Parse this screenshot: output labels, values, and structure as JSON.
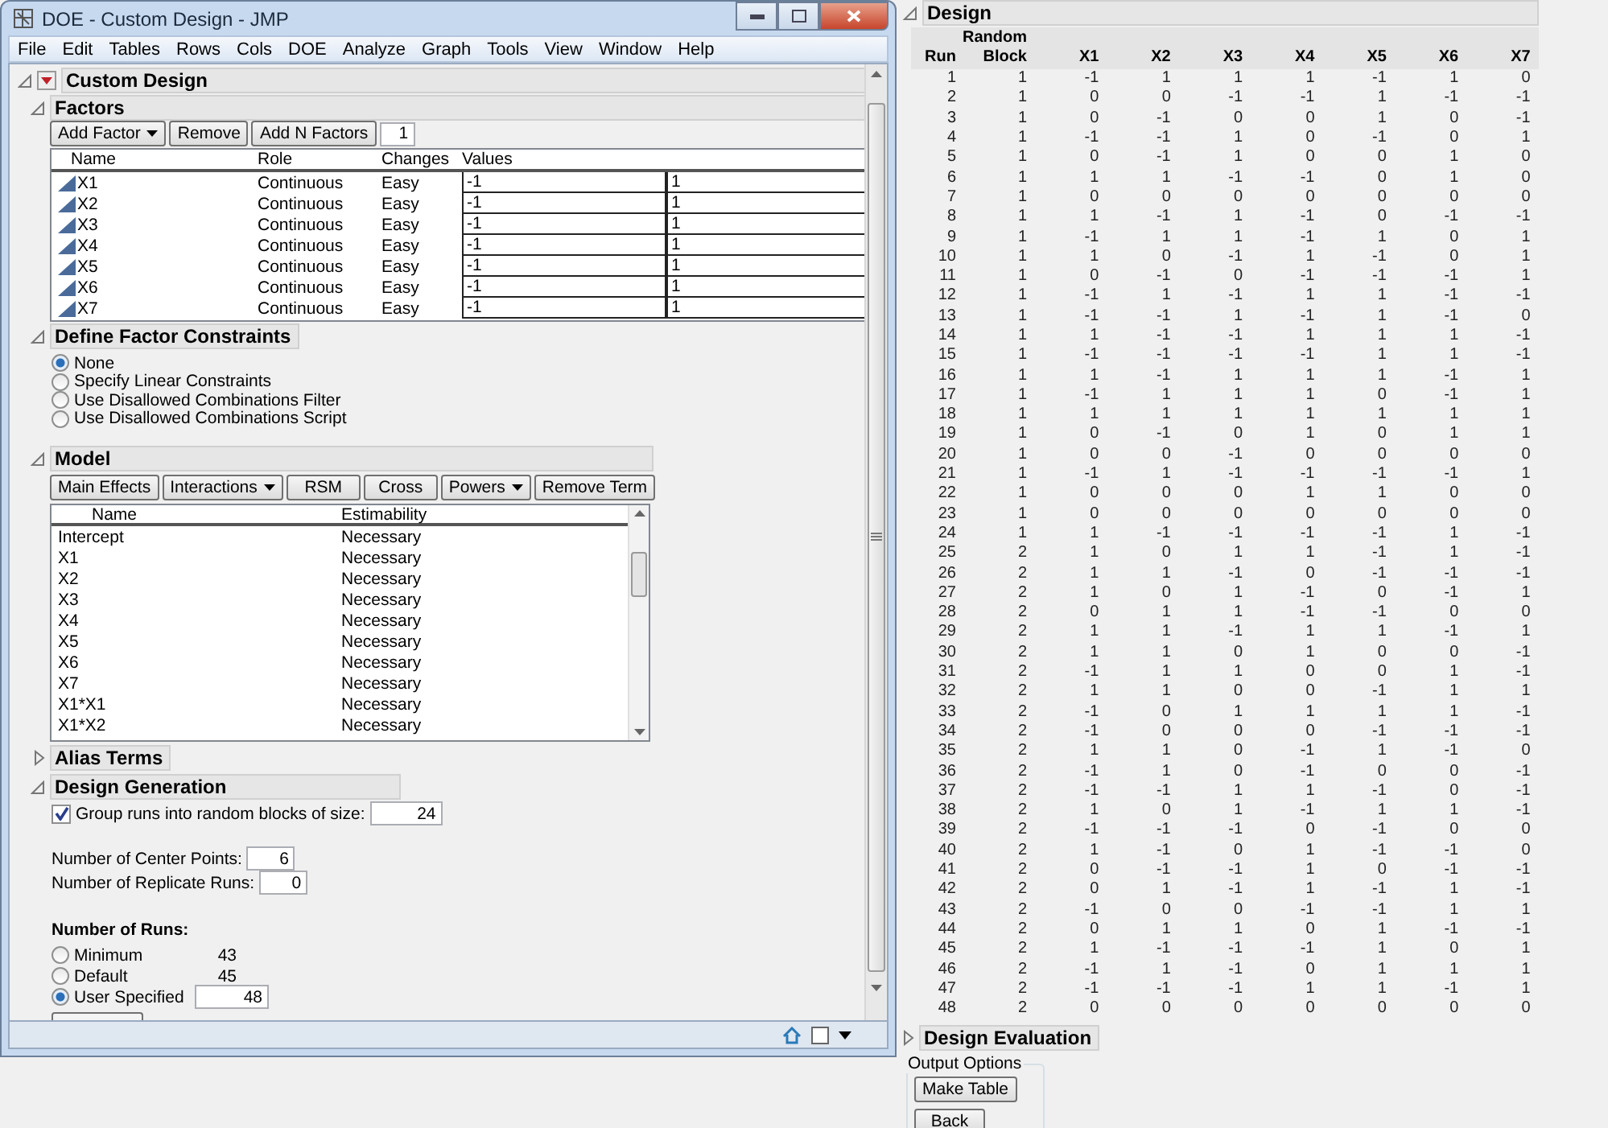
{
  "window": {
    "title": "DOE - Custom Design - JMP"
  },
  "menu": [
    "File",
    "Edit",
    "Tables",
    "Rows",
    "Cols",
    "DOE",
    "Analyze",
    "Graph",
    "Tools",
    "View",
    "Window",
    "Help"
  ],
  "custom_design": {
    "title": "Custom Design",
    "expanded": true
  },
  "factors": {
    "title": "Factors",
    "expanded": true,
    "buttons": [
      {
        "label": "Add Factor",
        "kind": "dropdown"
      },
      {
        "label": "Remove",
        "kind": "plain"
      },
      {
        "label": "Add N Factors",
        "kind": "plain"
      }
    ],
    "n_factors": "1",
    "columns": [
      "Name",
      "Role",
      "Changes",
      "Values"
    ],
    "rows": [
      {
        "name": "X1",
        "role": "Continuous",
        "changes": "Easy",
        "low": "-1",
        "high": "1"
      },
      {
        "name": "X2",
        "role": "Continuous",
        "changes": "Easy",
        "low": "-1",
        "high": "1"
      },
      {
        "name": "X3",
        "role": "Continuous",
        "changes": "Easy",
        "low": "-1",
        "high": "1"
      },
      {
        "name": "X4",
        "role": "Continuous",
        "changes": "Easy",
        "low": "-1",
        "high": "1"
      },
      {
        "name": "X5",
        "role": "Continuous",
        "changes": "Easy",
        "low": "-1",
        "high": "1"
      },
      {
        "name": "X6",
        "role": "Continuous",
        "changes": "Easy",
        "low": "-1",
        "high": "1"
      },
      {
        "name": "X7",
        "role": "Continuous",
        "changes": "Easy",
        "low": "-1",
        "high": "1"
      }
    ]
  },
  "constraints": {
    "title": "Define Factor Constraints",
    "expanded": true,
    "options": [
      {
        "label": "None",
        "selected": true
      },
      {
        "label": "Specify Linear Constraints",
        "selected": false
      },
      {
        "label": "Use Disallowed Combinations Filter",
        "selected": false
      },
      {
        "label": "Use Disallowed Combinations Script",
        "selected": false
      }
    ]
  },
  "model": {
    "title": "Model",
    "expanded": true,
    "buttons": [
      {
        "label": "Main Effects",
        "kind": "plain"
      },
      {
        "label": "Interactions",
        "kind": "dropdown"
      },
      {
        "label": "RSM",
        "kind": "plain"
      },
      {
        "label": "Cross",
        "kind": "plain"
      },
      {
        "label": "Powers",
        "kind": "dropdown"
      },
      {
        "label": "Remove Term",
        "kind": "plain"
      }
    ],
    "columns": [
      "Name",
      "Estimability"
    ],
    "rows": [
      {
        "name": "Intercept",
        "estimability": "Necessary"
      },
      {
        "name": "X1",
        "estimability": "Necessary"
      },
      {
        "name": "X2",
        "estimability": "Necessary"
      },
      {
        "name": "X3",
        "estimability": "Necessary"
      },
      {
        "name": "X4",
        "estimability": "Necessary"
      },
      {
        "name": "X5",
        "estimability": "Necessary"
      },
      {
        "name": "X6",
        "estimability": "Necessary"
      },
      {
        "name": "X7",
        "estimability": "Necessary"
      },
      {
        "name": "X1*X1",
        "estimability": "Necessary"
      },
      {
        "name": "X1*X2",
        "estimability": "Necessary"
      }
    ]
  },
  "alias_terms": {
    "title": "Alias Terms",
    "expanded": false
  },
  "design_generation": {
    "title": "Design Generation",
    "expanded": true,
    "group_runs": {
      "label": "Group runs into random blocks of size:",
      "checked": true,
      "value": "24"
    },
    "fields": [
      {
        "label": "Number of Center Points:",
        "value": "6"
      },
      {
        "label": "Number of Replicate Runs:",
        "value": "0"
      }
    ],
    "runs": {
      "title": "Number of Runs:",
      "options": [
        {
          "label": "Minimum",
          "kind": "count",
          "count": "43",
          "selected": false
        },
        {
          "label": "Default",
          "kind": "count",
          "count": "45",
          "selected": false
        },
        {
          "label": "User Specified",
          "kind": "field",
          "value": "48",
          "selected": true
        }
      ]
    }
  },
  "design": {
    "title": "Design",
    "expanded": true,
    "columns": [
      "Run",
      "Random Block",
      "X1",
      "X2",
      "X3",
      "X4",
      "X5",
      "X6",
      "X7"
    ],
    "rows": [
      [
        "1",
        "1",
        "-1",
        "1",
        "1",
        "1",
        "-1",
        "1",
        "0"
      ],
      [
        "2",
        "1",
        "0",
        "0",
        "-1",
        "-1",
        "1",
        "-1",
        "-1"
      ],
      [
        "3",
        "1",
        "0",
        "-1",
        "0",
        "0",
        "1",
        "0",
        "-1"
      ],
      [
        "4",
        "1",
        "-1",
        "-1",
        "1",
        "0",
        "-1",
        "0",
        "1"
      ],
      [
        "5",
        "1",
        "0",
        "-1",
        "1",
        "0",
        "0",
        "1",
        "0"
      ],
      [
        "6",
        "1",
        "1",
        "1",
        "-1",
        "-1",
        "0",
        "1",
        "0"
      ],
      [
        "7",
        "1",
        "0",
        "0",
        "0",
        "0",
        "0",
        "0",
        "0"
      ],
      [
        "8",
        "1",
        "1",
        "-1",
        "1",
        "-1",
        "0",
        "-1",
        "-1"
      ],
      [
        "9",
        "1",
        "-1",
        "1",
        "1",
        "-1",
        "1",
        "0",
        "1"
      ],
      [
        "10",
        "1",
        "1",
        "0",
        "-1",
        "1",
        "-1",
        "0",
        "1"
      ],
      [
        "11",
        "1",
        "0",
        "-1",
        "0",
        "-1",
        "-1",
        "-1",
        "1"
      ],
      [
        "12",
        "1",
        "-1",
        "1",
        "-1",
        "1",
        "1",
        "-1",
        "-1"
      ],
      [
        "13",
        "1",
        "-1",
        "-1",
        "1",
        "-1",
        "1",
        "-1",
        "0"
      ],
      [
        "14",
        "1",
        "1",
        "-1",
        "-1",
        "1",
        "1",
        "1",
        "-1"
      ],
      [
        "15",
        "1",
        "-1",
        "-1",
        "-1",
        "-1",
        "1",
        "1",
        "-1"
      ],
      [
        "16",
        "1",
        "1",
        "-1",
        "1",
        "1",
        "1",
        "-1",
        "1"
      ],
      [
        "17",
        "1",
        "-1",
        "1",
        "1",
        "1",
        "0",
        "-1",
        "1"
      ],
      [
        "18",
        "1",
        "1",
        "1",
        "1",
        "1",
        "1",
        "1",
        "1"
      ],
      [
        "19",
        "1",
        "0",
        "-1",
        "0",
        "1",
        "0",
        "1",
        "1"
      ],
      [
        "20",
        "1",
        "0",
        "0",
        "-1",
        "0",
        "0",
        "0",
        "0"
      ],
      [
        "21",
        "1",
        "-1",
        "1",
        "-1",
        "-1",
        "-1",
        "-1",
        "1"
      ],
      [
        "22",
        "1",
        "0",
        "0",
        "0",
        "1",
        "1",
        "0",
        "0"
      ],
      [
        "23",
        "1",
        "0",
        "0",
        "0",
        "0",
        "0",
        "0",
        "0"
      ],
      [
        "24",
        "1",
        "1",
        "-1",
        "-1",
        "-1",
        "-1",
        "1",
        "-1"
      ],
      [
        "25",
        "2",
        "1",
        "0",
        "1",
        "1",
        "-1",
        "1",
        "-1"
      ],
      [
        "26",
        "2",
        "1",
        "1",
        "-1",
        "0",
        "-1",
        "-1",
        "-1"
      ],
      [
        "27",
        "2",
        "1",
        "0",
        "1",
        "-1",
        "0",
        "-1",
        "1"
      ],
      [
        "28",
        "2",
        "0",
        "1",
        "1",
        "-1",
        "-1",
        "0",
        "0"
      ],
      [
        "29",
        "2",
        "1",
        "1",
        "-1",
        "1",
        "1",
        "-1",
        "1"
      ],
      [
        "30",
        "2",
        "1",
        "1",
        "0",
        "1",
        "0",
        "0",
        "-1"
      ],
      [
        "31",
        "2",
        "-1",
        "1",
        "1",
        "0",
        "0",
        "1",
        "-1"
      ],
      [
        "32",
        "2",
        "1",
        "1",
        "0",
        "0",
        "-1",
        "1",
        "1"
      ],
      [
        "33",
        "2",
        "-1",
        "0",
        "1",
        "1",
        "1",
        "1",
        "-1"
      ],
      [
        "34",
        "2",
        "-1",
        "0",
        "0",
        "0",
        "-1",
        "-1",
        "-1"
      ],
      [
        "35",
        "2",
        "1",
        "1",
        "0",
        "-1",
        "1",
        "-1",
        "0"
      ],
      [
        "36",
        "2",
        "-1",
        "1",
        "0",
        "-1",
        "0",
        "0",
        "-1"
      ],
      [
        "37",
        "2",
        "-1",
        "-1",
        "1",
        "1",
        "-1",
        "0",
        "-1"
      ],
      [
        "38",
        "2",
        "1",
        "0",
        "1",
        "-1",
        "1",
        "1",
        "-1"
      ],
      [
        "39",
        "2",
        "-1",
        "-1",
        "-1",
        "0",
        "-1",
        "0",
        "0"
      ],
      [
        "40",
        "2",
        "1",
        "-1",
        "0",
        "1",
        "-1",
        "-1",
        "0"
      ],
      [
        "41",
        "2",
        "0",
        "-1",
        "-1",
        "1",
        "0",
        "-1",
        "-1"
      ],
      [
        "42",
        "2",
        "0",
        "1",
        "-1",
        "1",
        "-1",
        "1",
        "-1"
      ],
      [
        "43",
        "2",
        "-1",
        "0",
        "0",
        "-1",
        "-1",
        "1",
        "1"
      ],
      [
        "44",
        "2",
        "0",
        "1",
        "1",
        "0",
        "1",
        "-1",
        "-1"
      ],
      [
        "45",
        "2",
        "1",
        "-1",
        "-1",
        "-1",
        "1",
        "0",
        "1"
      ],
      [
        "46",
        "2",
        "-1",
        "1",
        "-1",
        "0",
        "1",
        "1",
        "1"
      ],
      [
        "47",
        "2",
        "-1",
        "-1",
        "-1",
        "1",
        "1",
        "-1",
        "1"
      ],
      [
        "48",
        "2",
        "0",
        "0",
        "0",
        "0",
        "0",
        "0",
        "0"
      ]
    ]
  },
  "design_evaluation": {
    "title": "Design Evaluation",
    "expanded": false
  },
  "output_options": {
    "title": "Output Options",
    "buttons": [
      "Make Table",
      "Back"
    ]
  }
}
